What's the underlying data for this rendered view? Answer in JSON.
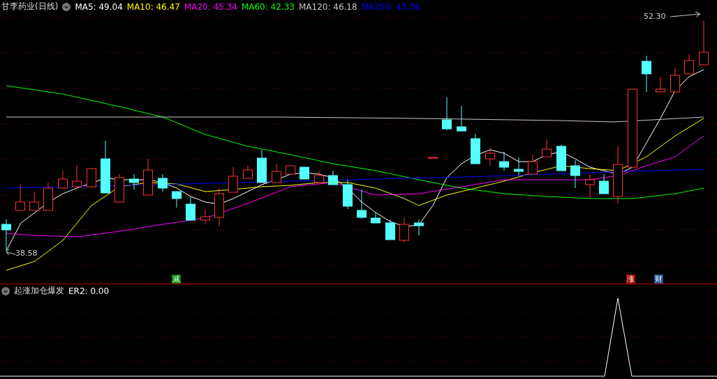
{
  "header": {
    "title": "甘李药业(日线)",
    "indicators": [
      {
        "label": "MA5: 49.04",
        "color": "#ffffff"
      },
      {
        "label": "MA10: 46.47",
        "color": "#ffff00"
      },
      {
        "label": "MA20: 45.34",
        "color": "#ff00ff"
      },
      {
        "label": "MA60: 42.33",
        "color": "#00ff00"
      },
      {
        "label": "MA120: 46.18",
        "color": "#c8c8c8"
      },
      {
        "label": "MA250: 43.38",
        "color": "#0000ff"
      }
    ]
  },
  "price_labels": {
    "high": "52.30",
    "low": "38.58"
  },
  "signals": [
    {
      "text": "减",
      "color": "#008000"
    },
    {
      "text": "涨",
      "color": "#a00000"
    },
    {
      "text": "财",
      "color": "#1a4f8a"
    }
  ],
  "sub_pane": {
    "title": "起涨加仓爆发",
    "indicators": [
      {
        "label": "ER2: 0.00",
        "color": "#ffffff"
      }
    ]
  }
}
